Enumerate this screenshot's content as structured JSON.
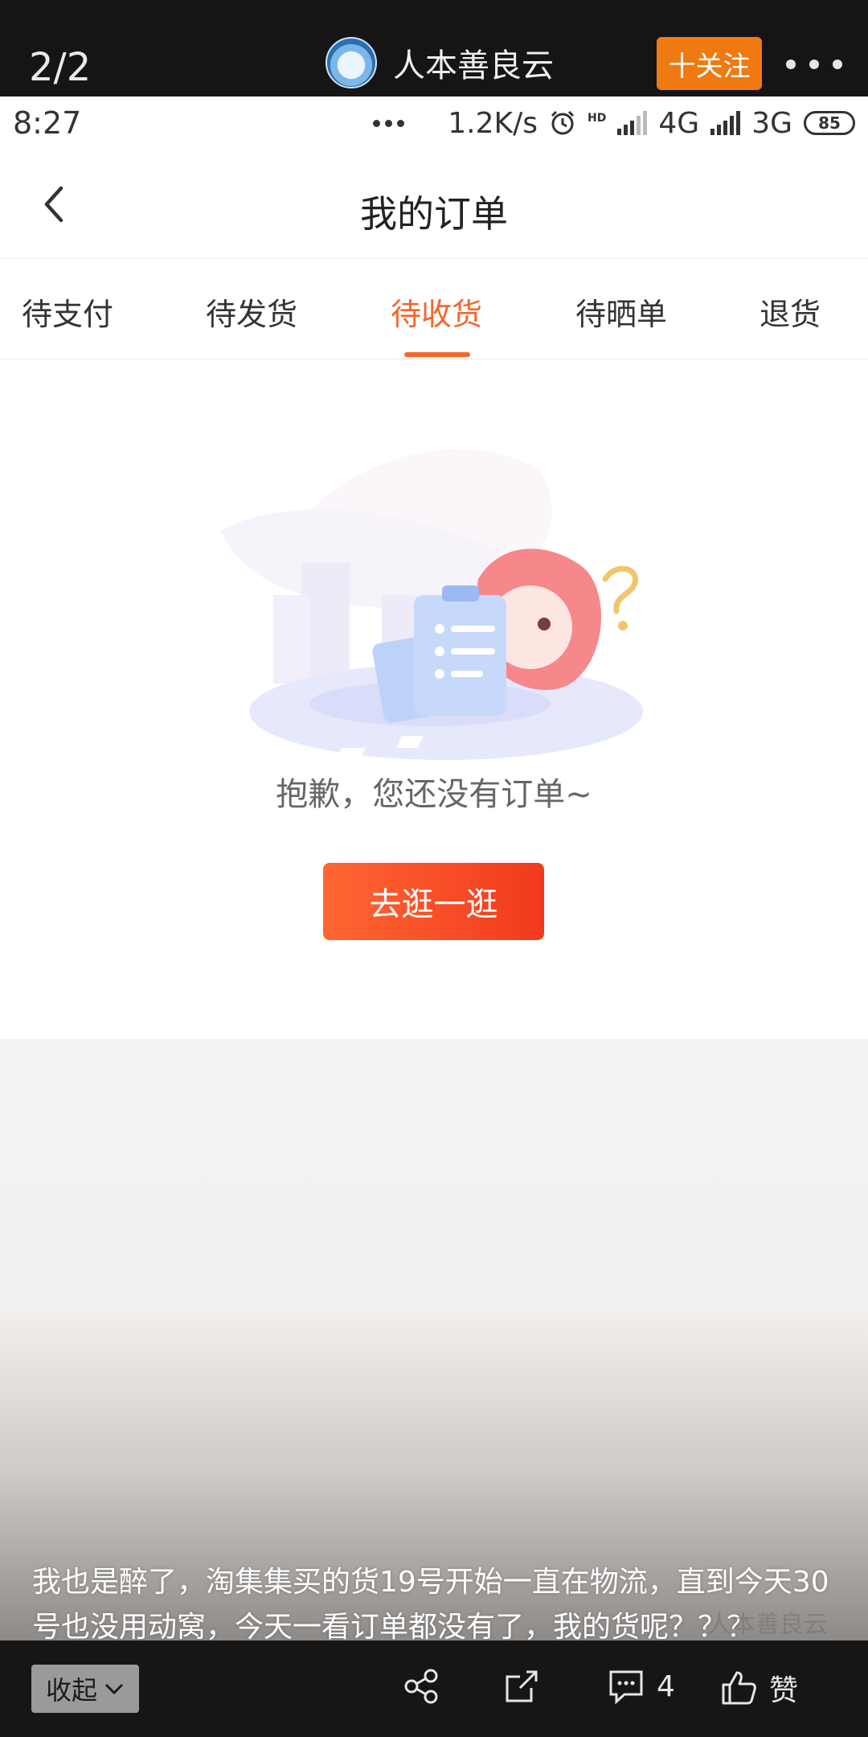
{
  "viewer": {
    "page_counter": "2/2",
    "author_name": "人本善良云",
    "follow_label": "十关注"
  },
  "status_bar": {
    "time": "8:27",
    "net_speed": "1.2K/s",
    "hd": "HD",
    "network_1": "4G",
    "network_2": "3G",
    "battery": "85"
  },
  "header": {
    "title": "我的订单"
  },
  "tabs": [
    {
      "label": "待支付",
      "active": false
    },
    {
      "label": "待发货",
      "active": false
    },
    {
      "label": "待收货",
      "active": true
    },
    {
      "label": "待晒单",
      "active": false
    },
    {
      "label": "退货",
      "active": false
    }
  ],
  "empty_state": {
    "message": "抱歉，您还没有订单~",
    "button_label": "去逛一逛"
  },
  "caption": {
    "text": "我也是醉了，淘集集买的货19号开始一直在物流，直到今天30号也没用动窝，今天一看订单都没有了，我的货呢？？？",
    "watermark": "人本善良云"
  },
  "bottom_bar": {
    "collapse_label": "收起",
    "comment_count": "4",
    "like_label": "赞"
  },
  "colors": {
    "accent": "#f5662a",
    "follow": "#f07a12",
    "button_gradient_start": "#ff6633",
    "button_gradient_end": "#f13a1c"
  }
}
